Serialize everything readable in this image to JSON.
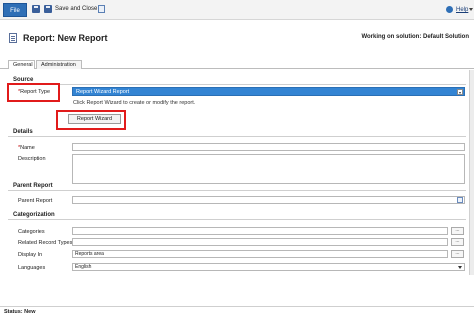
{
  "toolbar": {
    "file_label": "File",
    "save_close_label": "Save and Close",
    "help_label": "Help"
  },
  "header": {
    "title": "Report: New Report",
    "solution": "Working on solution: Default Solution"
  },
  "tabs": [
    {
      "label": "General"
    },
    {
      "label": "Administration"
    }
  ],
  "form": {
    "source": {
      "heading": "Source",
      "report_type_label": "Report Type",
      "report_type_value": "Report Wizard Report",
      "hint": "Click Report Wizard to create or modify the report.",
      "wizard_button": "Report Wizard"
    },
    "details": {
      "heading": "Details",
      "name_label": "Name",
      "description_label": "Description"
    },
    "parent": {
      "heading": "Parent Report",
      "parent_label": "Parent Report"
    },
    "categorization": {
      "heading": "Categorization",
      "categories_label": "Categories",
      "related_label": "Related Record Types",
      "display_label": "Display In",
      "display_value": "Reports area",
      "languages_label": "Languages",
      "languages_value": "English",
      "ellipsis": "..."
    }
  },
  "status": {
    "text": "Status: New"
  },
  "colors": {
    "accent": "#2f6fb6",
    "selection": "#3384d3",
    "highlight_box": "#e11b1b"
  }
}
